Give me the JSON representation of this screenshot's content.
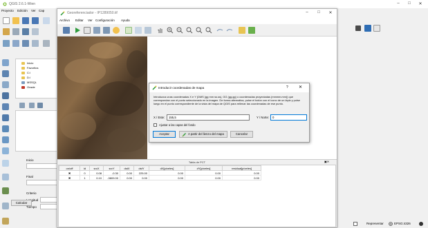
{
  "qgis": {
    "title": "QGIS 2.6.1-Wien",
    "menu": [
      "Proyecto",
      "Edición",
      "Ver",
      "Cap"
    ],
    "browser_items": [
      "Inicio",
      "Favoritos",
      "C:/",
      "D:/",
      "MSSQL",
      "Oracle"
    ],
    "georef_fields": {
      "inicio_label": "Inicio",
      "final_label": "Final",
      "criterio_label": "Criterio",
      "longitud_label": "Longitud",
      "tiempo_label": "Tiempo",
      "calc_button": "Calcular"
    },
    "status": {
      "render_label": "Representar",
      "crs_label": "EPSG:4326"
    }
  },
  "georef": {
    "title": "Georeferenciador - IP1289050.tif",
    "menu": [
      "Archivo",
      "Editar",
      "Ver",
      "Configuración",
      "Ayuda"
    ],
    "gcp_table": {
      "title": "Tabla de PCT",
      "columns": [
        "on/off",
        "id",
        "srcX",
        "srcY",
        "dstX",
        "dstY",
        "dX[píxeles]",
        "dY[píxeles]",
        "residual[píxeles]"
      ],
      "rows": [
        [
          "✖",
          "0",
          "0.08",
          "-0.30",
          "0.00",
          "225.00",
          "0.00",
          "0.00",
          "0.00"
        ],
        [
          "✖",
          "1",
          "0.10",
          "-3809.00",
          "0.00",
          "0.00",
          "0.00",
          "0.00",
          "0.00"
        ]
      ]
    }
  },
  "dialog": {
    "title": "Introducir coordenadas de mapa",
    "help": "?",
    "close": "✕",
    "message": "Introduzca unas coordenadas X e Y (DMS (gg mm ss.ss), GG (gg.gg) o coordenadas proyectadas (mmmm.mm)) que correspondan con el punto seleccionado en la imagen. De forma alternativa, pulse el botón con el icono de un lápiz y pulse luego en el punto correspondiente de la vista del mapa de QGIS para rellenar las coordenadas de ese punto.",
    "x_label": "X / Este:",
    "x_value": "155,5",
    "y_label": "Y / Norte:",
    "y_value": "0",
    "snap_label": "Ajustar a las capas del fondo",
    "accept_button": "Aceptar",
    "canvas_button": "A partir del lienzo del mapa",
    "cancel_button": "Cancelar"
  }
}
